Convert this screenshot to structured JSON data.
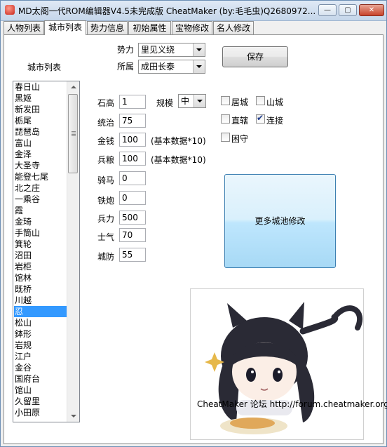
{
  "window": {
    "title": "MD太阁一代ROM编辑器V4.5未完成版  CheatMaker (by:毛毛虫)Q2680972...",
    "minimize_glyph": "—",
    "restore_glyph": "▢",
    "close_glyph": "✕"
  },
  "tabs": [
    {
      "label": "人物列表"
    },
    {
      "label": "城市列表"
    },
    {
      "label": "势力信息"
    },
    {
      "label": "初始属性"
    },
    {
      "label": "宝物修改"
    },
    {
      "label": "名人修改"
    }
  ],
  "city_list": {
    "heading": "城市列表",
    "items": [
      "春日山",
      "黑姬",
      "新发田",
      "栃尾",
      "琵琶岛",
      "富山",
      "金泽",
      "大圣寺",
      "能登七尾",
      "北之庄",
      "一乘谷",
      "霞",
      "金琦",
      "手筒山",
      "箕轮",
      "沼田",
      "岩柜",
      "馆林",
      "既桥",
      "川越",
      "忍",
      "松山",
      "鉢形",
      "岩规",
      "江户",
      "金谷",
      "国府台",
      "馆山",
      "久留里",
      "小田原"
    ],
    "selected": "忍"
  },
  "top_form": {
    "faction_label": "势力",
    "faction_value": "里见义绕",
    "belong_label": "所属",
    "belong_value": "成田长泰",
    "save_label": "保存"
  },
  "fields": {
    "shigao": {
      "label": "石高",
      "value": "1"
    },
    "tongzhi": {
      "label": "统治",
      "value": "75"
    },
    "jinqian": {
      "label": "金钱",
      "value": "100",
      "note": "(基本数据*10)"
    },
    "bingliang": {
      "label": "兵粮",
      "value": "100",
      "note": "(基本数据*10)"
    },
    "qima": {
      "label": "骑马",
      "value": "0"
    },
    "tiepao": {
      "label": "铁炮",
      "value": "0"
    },
    "bingli": {
      "label": "兵力",
      "value": "500"
    },
    "shiqi": {
      "label": "士气",
      "value": "70"
    },
    "chengfang": {
      "label": "城防",
      "value": "55"
    }
  },
  "scale": {
    "label": "规模",
    "value": "中"
  },
  "checks": {
    "jucheng": {
      "label": "居城",
      "checked": false
    },
    "shancheng": {
      "label": "山城",
      "checked": false
    },
    "zhixia": {
      "label": "直辖",
      "checked": false
    },
    "lianjie": {
      "label": "连接",
      "checked": true
    },
    "beishou": {
      "label": "困守",
      "checked": false
    }
  },
  "more_button_label": "更多城池修改",
  "footer": "CheatMaker 论坛 http://forum.cheatmaker.org/",
  "colors": {
    "selection": "#3399ff",
    "more_button": "#bee6fd"
  }
}
